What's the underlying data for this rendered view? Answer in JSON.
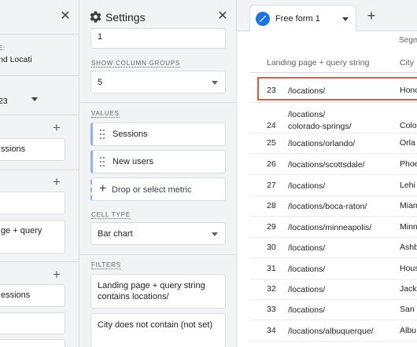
{
  "left_panel": {
    "label_partial": "E:",
    "value_partial": "nd Locati",
    "date_partial": "23",
    "section_boxes": [
      "ssions",
      "ge + query",
      "essions"
    ]
  },
  "settings": {
    "title": "Settings",
    "top_value": "1",
    "show_column_groups": {
      "label": "SHOW COLUMN GROUPS",
      "value": "5"
    },
    "values": {
      "label": "VALUES",
      "metrics": [
        "Sessions",
        "New users"
      ],
      "drop_placeholder": "Drop or select metric"
    },
    "cell_type": {
      "label": "CELL TYPE",
      "value": "Bar chart"
    },
    "filters": {
      "label": "FILTERS",
      "items": [
        "Landing page + query string contains locations/",
        "City does not contain (not set)"
      ]
    }
  },
  "canvas": {
    "tab_name": "Free form 1",
    "segment_header": "Segm",
    "columns": [
      "Landing page + query string",
      "City"
    ],
    "rows": [
      {
        "n": "23",
        "page": "/locations/",
        "city": "Hono"
      },
      {
        "n": "24",
        "page": "/locations/\ncolorado-springs/",
        "city": "Colo"
      },
      {
        "n": "25",
        "page": "/locations/orlando/",
        "city": "Orla"
      },
      {
        "n": "26",
        "page": "/locations/scottsdale/",
        "city": "Phoe"
      },
      {
        "n": "27",
        "page": "/locations/",
        "city": "Lehi"
      },
      {
        "n": "28",
        "page": "/locations/boca-raton/",
        "city": "Miam"
      },
      {
        "n": "29",
        "page": "/locations/minneapolis/",
        "city": "Minn"
      },
      {
        "n": "30",
        "page": "/locations/",
        "city": "Ashb"
      },
      {
        "n": "31",
        "page": "/locations/",
        "city": "Hous"
      },
      {
        "n": "32",
        "page": "/locations/",
        "city": "Jack"
      },
      {
        "n": "33",
        "page": "/locations/",
        "city": "San F"
      },
      {
        "n": "34",
        "page": "/locations/albuquerque/",
        "city": "Albu"
      }
    ]
  },
  "colors": {
    "accent": "#1a73e8",
    "highlight": "#e8543c",
    "panel_bg": "#f1f3f4",
    "chip_border": "#8ab4f8"
  },
  "icons": [
    "close-icon",
    "gear-icon",
    "pencil-icon",
    "chevron-down-icon",
    "plus-icon",
    "drag-handle-icon"
  ]
}
